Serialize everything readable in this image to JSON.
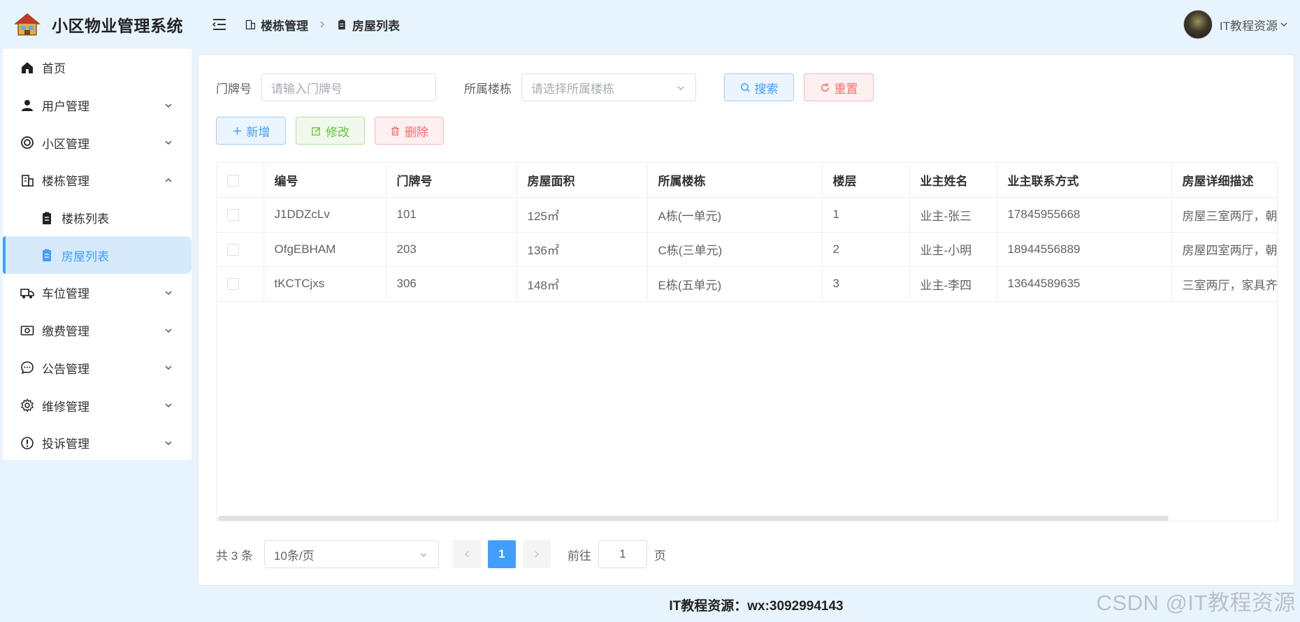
{
  "app": {
    "title": "小区物业管理系统"
  },
  "sidebar": {
    "items": [
      {
        "label": "首页",
        "icon": "home-icon"
      },
      {
        "label": "用户管理",
        "icon": "user-icon"
      },
      {
        "label": "小区管理",
        "icon": "lifebuoy-icon"
      },
      {
        "label": "楼栋管理",
        "icon": "building-icon"
      },
      {
        "label": "楼栋列表",
        "icon": "clipboard-icon"
      },
      {
        "label": "房屋列表",
        "icon": "clipboard-icon"
      },
      {
        "label": "车位管理",
        "icon": "truck-icon"
      },
      {
        "label": "缴费管理",
        "icon": "money-icon"
      },
      {
        "label": "公告管理",
        "icon": "chat-icon"
      },
      {
        "label": "维修管理",
        "icon": "gear-icon"
      },
      {
        "label": "投诉管理",
        "icon": "warning-icon"
      }
    ]
  },
  "header": {
    "breadcrumb": [
      "楼栋管理",
      "房屋列表"
    ],
    "user_name": "IT教程资源"
  },
  "search": {
    "door_label": "门牌号",
    "door_placeholder": "请输入门牌号",
    "building_label": "所属楼栋",
    "building_placeholder": "请选择所属楼栋",
    "search_label": "搜索",
    "reset_label": "重置"
  },
  "toolbar": {
    "add_label": "新增",
    "edit_label": "修改",
    "delete_label": "删除"
  },
  "table": {
    "columns": [
      "编号",
      "门牌号",
      "房屋面积",
      "所属楼栋",
      "楼层",
      "业主姓名",
      "业主联系方式",
      "房屋详细描述"
    ],
    "rows": [
      [
        "J1DDZcLv",
        "101",
        "125㎡",
        "A栋(一单元)",
        "1",
        "业主-张三",
        "17845955668",
        "房屋三室两厅，朝"
      ],
      [
        "OfgEBHAM",
        "203",
        "136㎡",
        "C栋(三单元)",
        "2",
        "业主-小明",
        "18944556889",
        "房屋四室两厅，朝"
      ],
      [
        "tKCTCjxs",
        "306",
        "148㎡",
        "E栋(五单元)",
        "3",
        "业主-李四",
        "13644589635",
        "三室两厅，家具齐"
      ]
    ]
  },
  "pagination": {
    "total_text": "共 3 条",
    "page_size": "10条/页",
    "current_page": "1",
    "goto_prefix": "前往",
    "goto_value": "1",
    "goto_suffix": "页"
  },
  "footer": {
    "text": "IT教程资源：wx:3092994143"
  },
  "watermark": "CSDN @IT教程资源",
  "colors": {
    "accent": "#409eff",
    "success": "#67c23a",
    "danger": "#f56c6c",
    "background": "#e8f4fd"
  }
}
